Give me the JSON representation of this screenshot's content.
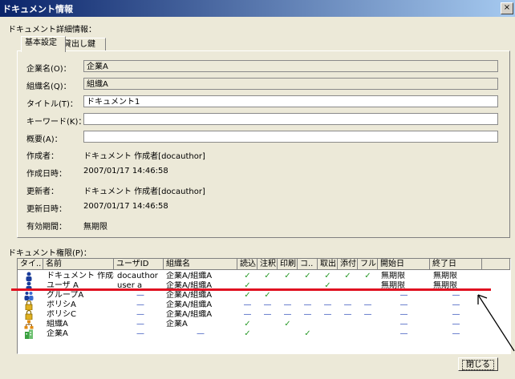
{
  "window": {
    "title": "ドキュメント情報",
    "close_glyph": "×"
  },
  "section_label": "ドキュメント詳細情報：",
  "tabs": [
    {
      "label": "基本設定"
    },
    {
      "label": "貸出し鍵"
    }
  ],
  "fields": [
    {
      "label": "企業名(O)：",
      "value": "企業A"
    },
    {
      "label": "組織名(Q)：",
      "value": "組織A"
    },
    {
      "label": "タイトル(T)：",
      "value": "ドキュメント1"
    },
    {
      "label": "キーワード(K)：",
      "value": ""
    },
    {
      "label": "概要(A)：",
      "value": ""
    }
  ],
  "info": [
    {
      "label": "作成者：",
      "value": "ドキュメント 作成者[docauthor]"
    },
    {
      "label": "作成日時：",
      "value": "2007/01/17 14:46:58"
    },
    {
      "label": "更新者：",
      "value": "ドキュメント 作成者[docauthor]"
    },
    {
      "label": "更新日時：",
      "value": "2007/01/17 14:46:58"
    },
    {
      "label": "有効期間：",
      "value": "無期限"
    }
  ],
  "permissions_label": "ドキュメント権限(P)：",
  "columns": [
    "タイ..",
    "名前",
    "ユーザID",
    "組織名",
    "読込",
    "注釈",
    "印刷",
    "コ..",
    "取出",
    "添付",
    "フル",
    "開始日",
    "終了日"
  ],
  "rows": [
    {
      "icon": "user-icon",
      "name": "ドキュメント 作成者",
      "userid": "docauthor",
      "org": "企業A/組織A",
      "perms": [
        "✓",
        "✓",
        "✓",
        "✓",
        "✓",
        "✓",
        "✓"
      ],
      "start": "無期限",
      "end": "無期限"
    },
    {
      "icon": "user-icon",
      "name": "ユーザ A",
      "userid": "user a",
      "org": "企業A/組織A",
      "perms": [
        "✓",
        "",
        "",
        "",
        "✓",
        "",
        ""
      ],
      "start": "無期限",
      "end": "無期限"
    },
    {
      "icon": "group-icon",
      "name": "グループA",
      "userid": "—",
      "org": "企業A/組織A",
      "perms": [
        "✓",
        "✓",
        "",
        "",
        "",
        "",
        ""
      ],
      "start": "—",
      "end": "—"
    },
    {
      "icon": "policy-icon",
      "name": "ポリシA",
      "userid": "—",
      "org": "企業A/組織A",
      "perms": [
        "—",
        "—",
        "—",
        "—",
        "—",
        "—",
        "—"
      ],
      "start": "—",
      "end": "—"
    },
    {
      "icon": "policy-icon",
      "name": "ポリシC",
      "userid": "—",
      "org": "企業A/組織A",
      "perms": [
        "—",
        "—",
        "—",
        "—",
        "—",
        "—",
        "—"
      ],
      "start": "—",
      "end": "—"
    },
    {
      "icon": "org-icon",
      "name": "組織A",
      "userid": "—",
      "org": "企業A",
      "perms": [
        "✓",
        "",
        "✓",
        "",
        "",
        "",
        ""
      ],
      "start": "—",
      "end": "—"
    },
    {
      "icon": "company-icon",
      "name": "企業A",
      "userid": "—",
      "org": "—",
      "perms": [
        "✓",
        "",
        "",
        "✓",
        "",
        "",
        ""
      ],
      "start": "—",
      "end": "—"
    }
  ],
  "close_button": "閉じる"
}
